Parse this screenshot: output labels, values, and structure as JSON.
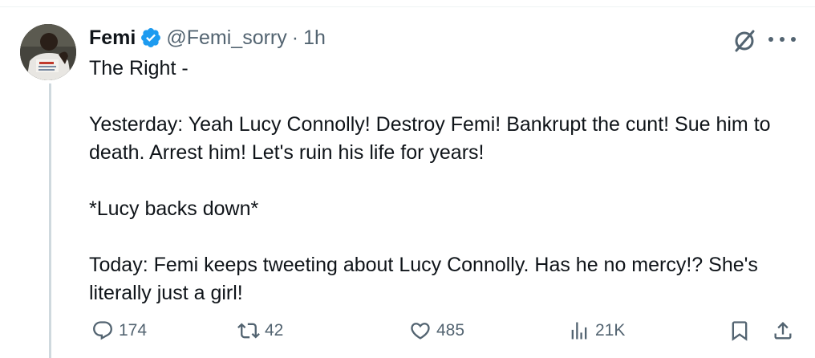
{
  "tweet": {
    "author": {
      "name": "Femi",
      "handle": "@Femi_sorry",
      "verified": true,
      "avatar_icon": "user-avatar-photo"
    },
    "separator": "·",
    "timestamp": "1h",
    "paragraphs": [
      "The Right -",
      "",
      "Yesterday: Yeah Lucy Connolly! Destroy Femi! Bankrupt the cunt! Sue him to death. Arrest him! Let's ruin his life for years!",
      "",
      "*Lucy backs down*",
      "",
      "Today: Femi keeps tweeting about Lucy Connolly. Has he no mercy!? She's literally just a girl!"
    ],
    "stats": {
      "replies": "174",
      "retweets": "42",
      "likes": "485",
      "views": "21K"
    }
  },
  "icons": {
    "verified": "verified-badge-icon",
    "grok": "grok-icon",
    "more": "more-icon",
    "reply": "reply-icon",
    "retweet": "retweet-icon",
    "like": "heart-icon",
    "views": "views-icon",
    "bookmark": "bookmark-icon",
    "share": "share-icon"
  },
  "colors": {
    "text_primary": "#0f1419",
    "text_secondary": "#536471",
    "verified_blue": "#1d9bf0",
    "thread_line": "#cfd9de"
  }
}
